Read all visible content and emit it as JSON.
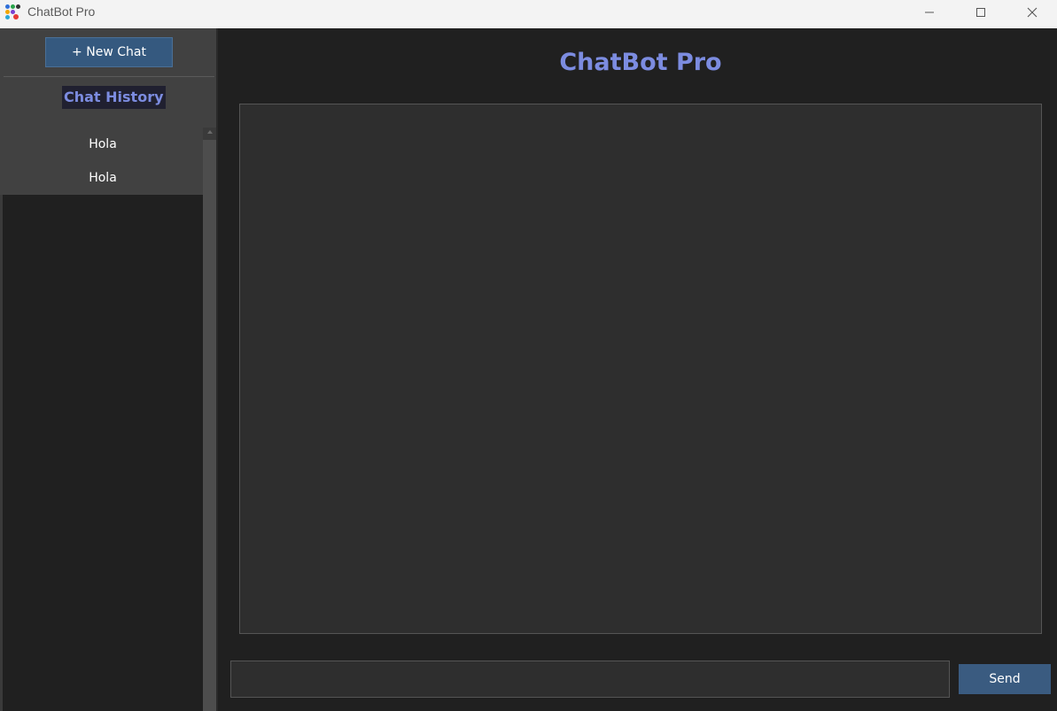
{
  "window": {
    "title": "ChatBot Pro",
    "app_icon": "chatbot-app-icon",
    "controls": [
      "minimize-icon",
      "maximize-icon",
      "close-icon"
    ]
  },
  "sidebar": {
    "new_chat_label": "+ New Chat",
    "history_heading": "Chat History",
    "history_items": [
      {
        "label": "Hola"
      },
      {
        "label": "Hola"
      }
    ]
  },
  "main": {
    "title": "ChatBot Pro",
    "input": {
      "value": "",
      "placeholder": ""
    },
    "send_label": "Send"
  },
  "colors": {
    "accent": "#7c8ce0",
    "button": "#35597f",
    "background": "#202020",
    "panel": "#2e2e2e"
  }
}
